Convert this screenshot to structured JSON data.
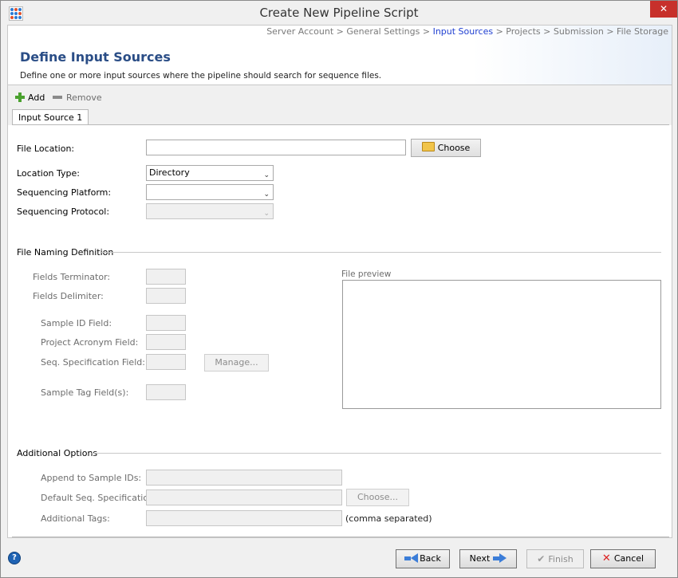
{
  "window": {
    "title": "Create New Pipeline Script",
    "close_glyph": "✕"
  },
  "breadcrumb": {
    "items": [
      {
        "label": "Server Account",
        "sep": " > "
      },
      {
        "label": "General Settings",
        "sep": " > "
      },
      {
        "label": "Input Sources",
        "sep": " > "
      },
      {
        "label": "Projects",
        "sep": " > "
      },
      {
        "label": "Submission",
        "sep": " > "
      },
      {
        "label": "File Storage",
        "sep": ""
      }
    ],
    "active_index": 2
  },
  "header": {
    "title": "Define Input Sources",
    "description": "Define one or more input sources where the pipeline should search for sequence files."
  },
  "toolbar": {
    "add_label": "Add",
    "remove_label": "Remove"
  },
  "tabs": [
    {
      "label": "Input Source 1",
      "active": true
    }
  ],
  "form": {
    "file_location_label": "File Location:",
    "file_location_value": "",
    "choose_label": "Choose",
    "location_type_label": "Location Type:",
    "location_type_value": "Directory",
    "platform_label": "Sequencing Platform:",
    "platform_value": "",
    "protocol_label": "Sequencing Protocol:",
    "protocol_value": ""
  },
  "naming": {
    "section_label": "File Naming Definition",
    "fields_terminator_label": "Fields Terminator:",
    "fields_delimiter_label": "Fields Delimiter:",
    "sample_id_label": "Sample ID Field:",
    "project_acronym_label": "Project Acronym Field:",
    "seq_spec_label": "Seq. Specification Field:",
    "manage_label": "Manage...",
    "sample_tag_label": "Sample Tag Field(s):",
    "preview_label": "File preview"
  },
  "additional": {
    "section_label": "Additional Options",
    "append_label": "Append to Sample IDs:",
    "default_spec_label": "Default Seq. Specification:",
    "choose_label": "Choose...",
    "tags_label": "Additional Tags:",
    "tags_hint": "(comma separated)"
  },
  "footer": {
    "help_glyph": "?",
    "back_label": "Back",
    "next_label": "Next",
    "finish_label": "Finish",
    "cancel_label": "Cancel"
  },
  "colors": {
    "title_blue": "#2a4d86",
    "crumb_active": "#1f3fd1",
    "close_red": "#c7302b"
  }
}
